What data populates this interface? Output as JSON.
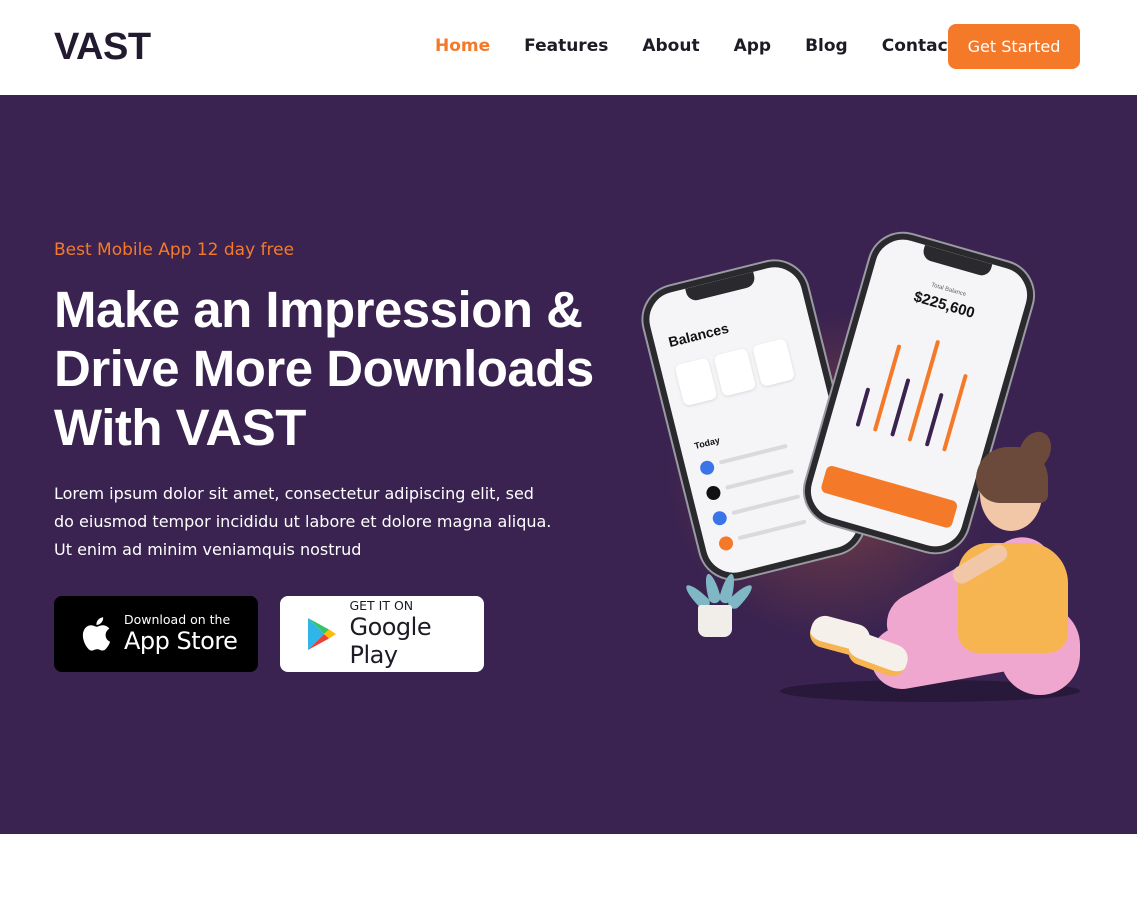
{
  "brand": {
    "logo": "VAST",
    "accent": "#f47a2a",
    "hero_bg": "#3a2350"
  },
  "nav": {
    "items": [
      {
        "label": "Home",
        "active": true
      },
      {
        "label": "Features"
      },
      {
        "label": "About"
      },
      {
        "label": "App"
      },
      {
        "label": "Blog"
      },
      {
        "label": "Contact"
      }
    ],
    "cta_label": "Get Started"
  },
  "hero": {
    "tagline": "Best Mobile App 12 day free",
    "headline_lines": [
      "Make an Impression &",
      "Drive More Downloads",
      "With VAST"
    ],
    "description": "Lorem ipsum dolor sit amet, consectetur adipiscing elit, sed do eiusmod tempor incididu ut labore et dolore magna aliqua. Ut enim ad minim veniamquis nostrud",
    "app_store": {
      "small": "Download on the",
      "big": "App Store",
      "icon": "apple-icon"
    },
    "google_play": {
      "small": "GET IT ON",
      "big": "Google Play",
      "icon": "google-play-icon"
    }
  },
  "illustration": {
    "phone1": {
      "title": "Balances",
      "section": "Today"
    },
    "phone2": {
      "label": "Total Balance",
      "amount": "$225,600"
    }
  }
}
